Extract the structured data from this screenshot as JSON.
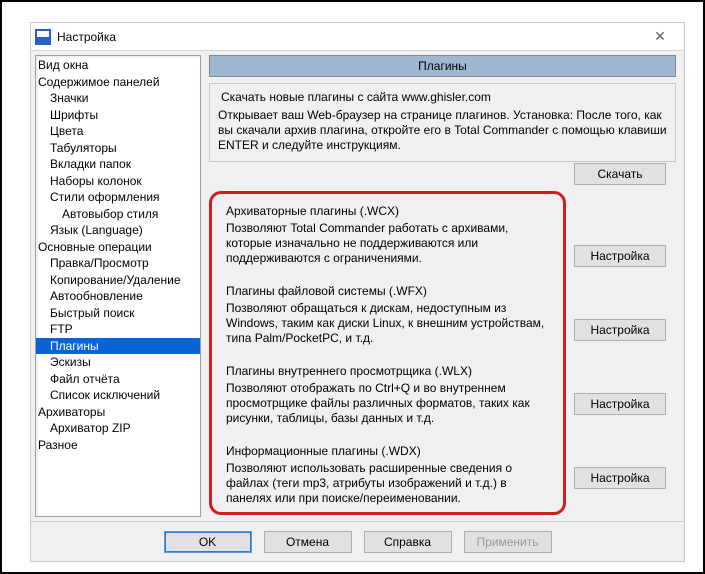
{
  "window": {
    "title": "Настройка",
    "close_glyph": "✕"
  },
  "tree": {
    "items": [
      {
        "label": "Вид окна",
        "indent": 0
      },
      {
        "label": "Содержимое панелей",
        "indent": 0
      },
      {
        "label": "Значки",
        "indent": 1
      },
      {
        "label": "Шрифты",
        "indent": 1
      },
      {
        "label": "Цвета",
        "indent": 1
      },
      {
        "label": "Табуляторы",
        "indent": 1
      },
      {
        "label": "Вкладки папок",
        "indent": 1
      },
      {
        "label": "Наборы колонок",
        "indent": 1
      },
      {
        "label": "Стили оформления",
        "indent": 1
      },
      {
        "label": "Автовыбор стиля",
        "indent": 2
      },
      {
        "label": "Язык (Language)",
        "indent": 1
      },
      {
        "label": "Основные операции",
        "indent": 0
      },
      {
        "label": "Правка/Просмотр",
        "indent": 1
      },
      {
        "label": "Копирование/Удаление",
        "indent": 1
      },
      {
        "label": "Автообновление",
        "indent": 1
      },
      {
        "label": "Быстрый поиск",
        "indent": 1
      },
      {
        "label": "FTP",
        "indent": 1
      },
      {
        "label": "Плагины",
        "indent": 1,
        "selected": true
      },
      {
        "label": "Эскизы",
        "indent": 1
      },
      {
        "label": "Файл отчёта",
        "indent": 1
      },
      {
        "label": "Список исключений",
        "indent": 1
      },
      {
        "label": "Архиваторы",
        "indent": 0
      },
      {
        "label": "Архиватор ZIP",
        "indent": 1
      },
      {
        "label": "Разное",
        "indent": 0
      }
    ]
  },
  "page": {
    "header": "Плагины",
    "top_caption": "Скачать новые плагины с сайта www.ghisler.com",
    "top_desc": "Открывает ваш Web-браузер на странице плагинов. Установка: После того, как вы скачали архив плагина, откройте его в Total Commander с помощью клавиши ENTER и следуйте инструкциям.",
    "download_label": "Скачать",
    "configure_label": "Настройка",
    "sections": [
      {
        "title": "Архиваторные плагины (.WCX)",
        "desc": "Позволяют Total Commander работать с архивами, которые изначально не поддерживаются или поддерживаются с ограничениями."
      },
      {
        "title": "Плагины файловой системы (.WFX)",
        "desc": "Позволяют обращаться к дискам, недоступным из Windows, таким как диски Linux, к внешним устройствам, типа Palm/PocketPC, и т.д."
      },
      {
        "title": "Плагины внутреннего просмотрщика (.WLX)",
        "desc": "Позволяют отображать по Ctrl+Q и во внутреннем просмотрщике файлы различных форматов, таких как рисунки, таблицы, базы данных и т.д."
      },
      {
        "title": "Информационные плагины (.WDX)",
        "desc": "Позволяют использовать расширенные сведения о файлах (теги mp3, атрибуты изображений и т.д.) в панелях или при поиске/переименовании."
      }
    ]
  },
  "footer": {
    "ok": "OK",
    "cancel": "Отмена",
    "help": "Справка",
    "apply": "Применить"
  }
}
